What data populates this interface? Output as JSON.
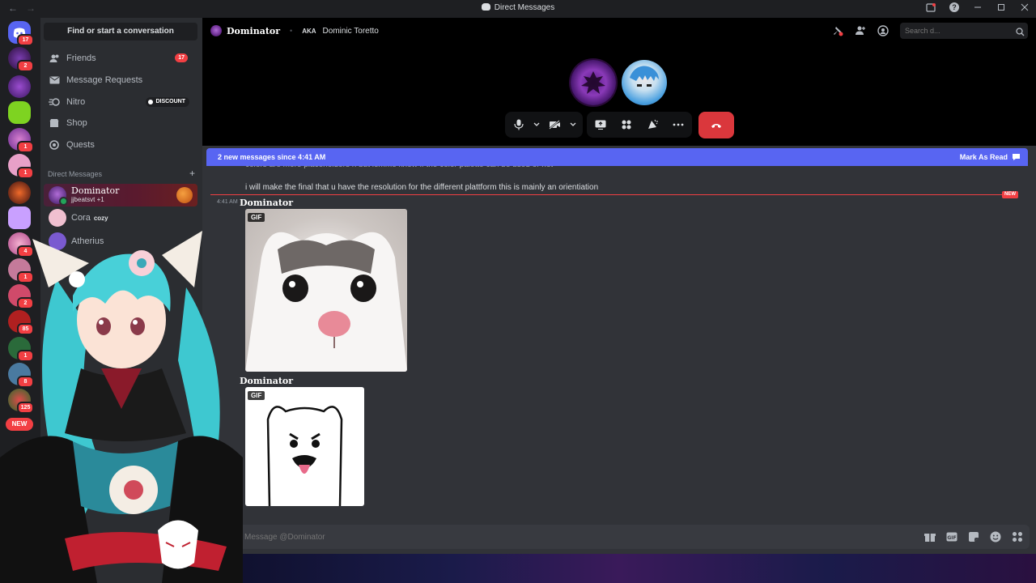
{
  "window": {
    "title": "Direct Messages"
  },
  "titlebar": {
    "back": "←",
    "forward": "→"
  },
  "rail": {
    "servers": [
      {
        "badge": "17"
      },
      {
        "badge": "2"
      },
      {
        "badge": ""
      },
      {
        "badge": ""
      },
      {
        "badge": "1"
      },
      {
        "badge": "1"
      },
      {
        "badge": ""
      },
      {
        "badge": ""
      },
      {
        "badge": "4"
      },
      {
        "badge": "1"
      },
      {
        "badge": "2"
      },
      {
        "badge": "85"
      },
      {
        "badge": "1"
      },
      {
        "badge": "8"
      },
      {
        "badge": "125"
      }
    ],
    "new_label": "NEW"
  },
  "sidebar": {
    "search_label": "Find or start a conversation",
    "nav": {
      "friends": "Friends",
      "friends_badge": "17",
      "message_requests": "Message Requests",
      "nitro": "Nitro",
      "discount": "DISCOUNT",
      "shop": "Shop",
      "quests": "Quests"
    },
    "dm_header": "Direct Messages",
    "dm_add": "+",
    "dms": [
      {
        "name": "Dominator",
        "sub": "jjbeatsvt +1"
      },
      {
        "name": "Cora",
        "sub": "cozy"
      },
      {
        "name": "Atherius",
        "sub": ""
      }
    ]
  },
  "header": {
    "username": "Dominator",
    "aka_label": "AKA",
    "aka_name": "Dominic Toretto",
    "search_placeholder": "Search d..."
  },
  "newbar": {
    "text": "2 new messages since 4:41 AM",
    "mark_read": "Mark As Read"
  },
  "chat": {
    "cutoff_text": "colors are more placeholders n but lemme know if the color palette can be used or not",
    "message": "i will make the final that u have the resolution for the different plattform this is mainly an orientiation",
    "new_tag": "NEW",
    "timestamp": "4:41 AM",
    "author": "Dominator",
    "author2": "Dominator",
    "gif_tag": "GIF"
  },
  "composer": {
    "placeholder": "Message @Dominator"
  },
  "colors": {
    "accent": "#5865f2",
    "danger": "#da373c",
    "online": "#23a55a"
  }
}
